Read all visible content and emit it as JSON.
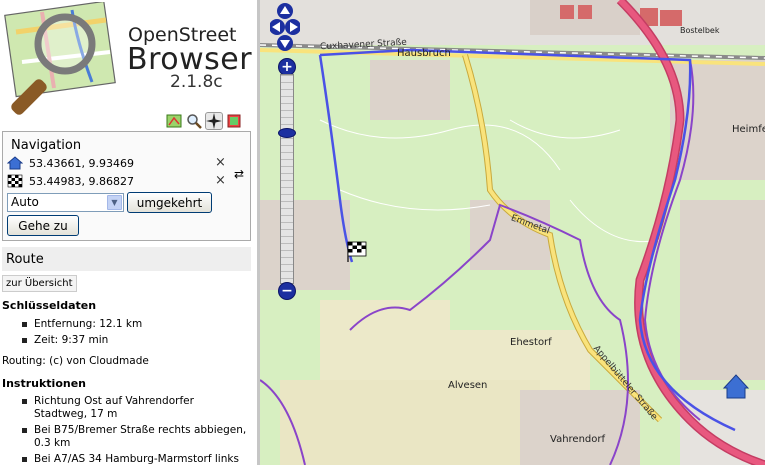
{
  "app": {
    "name_line1": "OpenStreet",
    "name_line2": "Browser",
    "version": "2.1.8c"
  },
  "toolbar": {
    "tools": [
      "map-icon",
      "magnifier-icon",
      "compass-icon",
      "layers-icon"
    ]
  },
  "navigation": {
    "title": "Navigation",
    "start_coords": "53.43661, 9.93469",
    "end_coords": "53.44983, 9.86827",
    "close_symbol": "×",
    "swap_symbol": "⇄",
    "mode_selected": "Auto",
    "reverse_label": "umgekehrt",
    "go_label": "Gehe zu"
  },
  "route": {
    "title": "Route",
    "overview_label": "zur Übersicht",
    "key_data_title": "Schlüsseldaten",
    "distance": "Entfernung: 12.1 km",
    "time": "Zeit: 9:37 min",
    "routing_credit": "Routing: (c) von Cloudmade",
    "instructions_title": "Instruktionen",
    "instructions": [
      "Richtung Ost auf Vahrendorfer Stadtweg, 17 m",
      "Bei B75/Bremer Straße rechts abbiegen, 0.3 km",
      "Bei A7/AS 34 Hamburg-Marmstorf links"
    ]
  },
  "map": {
    "places": {
      "hausbruch": "Hausbruch",
      "heimfeld": "Heimfe",
      "ehestorf": "Ehestorf",
      "alvesen": "Alvesen",
      "vahrendorf": "Vahrendorf",
      "bostelbek": "Bostelbek"
    },
    "roads": {
      "cuxhavener": "Cuxhavener Straße",
      "emmetal": "Emmetal",
      "appelbuetteler": "Appelbütteler Straße"
    },
    "colors": {
      "background": "#d7efc1",
      "route": "#4a52e6",
      "motorway": "#e8587f",
      "main_road": "#f9e37c",
      "boundary": "#8a44c9"
    }
  }
}
